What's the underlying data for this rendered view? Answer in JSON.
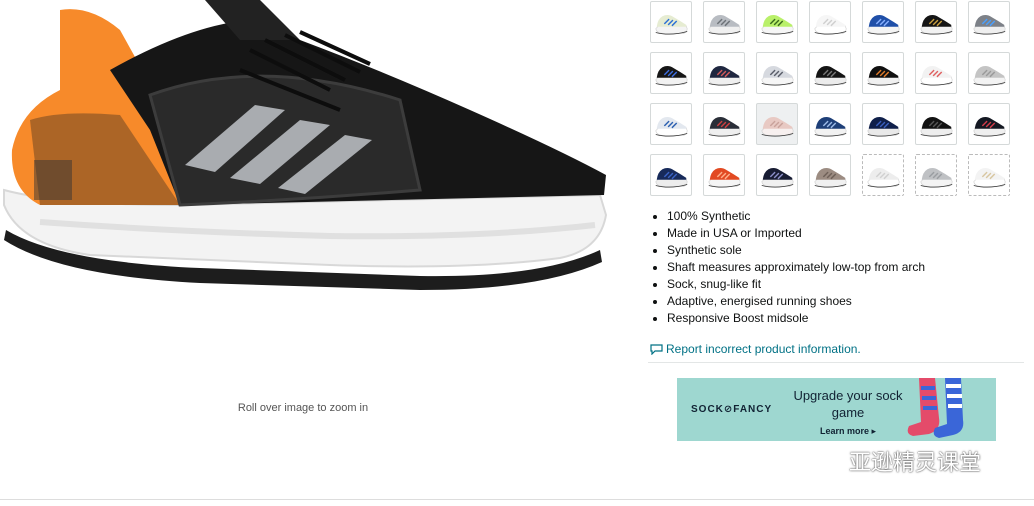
{
  "product": {
    "zoom_hint": "Roll over image to zoom in",
    "hero_icon": "running-shoe-image"
  },
  "swatches": [
    {
      "body": "#e6ecd2",
      "accent": "#2a6fd6",
      "sole": "#f4f4f4",
      "state": "available"
    },
    {
      "body": "#b8bcc2",
      "accent": "#6d7278",
      "sole": "#f0f0f0",
      "state": "available"
    },
    {
      "body": "#b9f06a",
      "accent": "#3b6b1e",
      "sole": "#f6f6f6",
      "state": "available"
    },
    {
      "body": "#f6f6f6",
      "accent": "#cfcfcf",
      "sole": "#ffffff",
      "state": "available"
    },
    {
      "body": "#1f4fa8",
      "accent": "#88b0ff",
      "sole": "#f4f4f4",
      "state": "available"
    },
    {
      "body": "#151515",
      "accent": "#c9a040",
      "sole": "#f2f2f2",
      "state": "available"
    },
    {
      "body": "#7d8188",
      "accent": "#4aa0ff",
      "sole": "#efefef",
      "state": "available"
    },
    {
      "body": "#161616",
      "accent": "#3d6de0",
      "sole": "#f2f2f2",
      "state": "available"
    },
    {
      "body": "#1f2740",
      "accent": "#d35a5a",
      "sole": "#efefef",
      "state": "available"
    },
    {
      "body": "#d6d9df",
      "accent": "#5a5e6a",
      "sole": "#f6f6f6",
      "state": "available"
    },
    {
      "body": "#141414",
      "accent": "#777777",
      "sole": "#ececec",
      "state": "available"
    },
    {
      "body": "#101010",
      "accent": "#e07b2a",
      "sole": "#f0f0f0",
      "state": "available"
    },
    {
      "body": "#f2f2f2",
      "accent": "#e06060",
      "sole": "#ffffff",
      "state": "available"
    },
    {
      "body": "#c4c4c4",
      "accent": "#9a9a9a",
      "sole": "#f3f3f3",
      "state": "available"
    },
    {
      "body": "#e3e8ef",
      "accent": "#2b5fb0",
      "sole": "#ffffff",
      "state": "available"
    },
    {
      "body": "#2a2e38",
      "accent": "#d04040",
      "sole": "#efefef",
      "state": "available"
    },
    {
      "body": "#e8c9c3",
      "accent": "#c9a29b",
      "sole": "#f7f0ef",
      "state": "selected"
    },
    {
      "body": "#1e3f78",
      "accent": "#9dbbe8",
      "sole": "#f2f2f2",
      "state": "available"
    },
    {
      "body": "#0f1f4a",
      "accent": "#3a5fbf",
      "sole": "#e9e9e9",
      "state": "available"
    },
    {
      "body": "#121212",
      "accent": "#555555",
      "sole": "#eeeeee",
      "state": "available"
    },
    {
      "body": "#141822",
      "accent": "#d23c4a",
      "sole": "#efefef",
      "state": "available"
    },
    {
      "body": "#172a5a",
      "accent": "#3a62c4",
      "sole": "#ededed",
      "state": "available"
    },
    {
      "body": "#e24a22",
      "accent": "#ffb08a",
      "sole": "#f5f5f5",
      "state": "available"
    },
    {
      "body": "#171c33",
      "accent": "#8b8fc9",
      "sole": "#f0f0f0",
      "state": "available"
    },
    {
      "body": "#9c8c82",
      "accent": "#6e6058",
      "sole": "#f1f1f1",
      "state": "available"
    },
    {
      "body": "#ededed",
      "accent": "#d0d0d0",
      "sole": "#ffffff",
      "state": "unavailable"
    },
    {
      "body": "#bfc1c4",
      "accent": "#9a9da1",
      "sole": "#f4f4f4",
      "state": "unavailable"
    },
    {
      "body": "#f3f3f3",
      "accent": "#d8c6a0",
      "sole": "#ffffff",
      "state": "unavailable"
    }
  ],
  "bullets": [
    "100% Synthetic",
    "Made in USA or Imported",
    "Synthetic sole",
    "Shaft measures approximately low-top from arch",
    "Sock, snug-like fit",
    "Adaptive, energised running shoes",
    "Responsive Boost midsole"
  ],
  "report": {
    "label": "Report incorrect product information.",
    "icon": "comment-icon",
    "color": "#007185"
  },
  "ad": {
    "brand": "SOCK⊘FANCY",
    "headline": "Upgrade your sock game",
    "cta": "Learn more ▸",
    "bg": "#9ed7d0"
  },
  "watermark": {
    "text": "亚逊精灵课堂",
    "icon": "wechat-icon"
  }
}
